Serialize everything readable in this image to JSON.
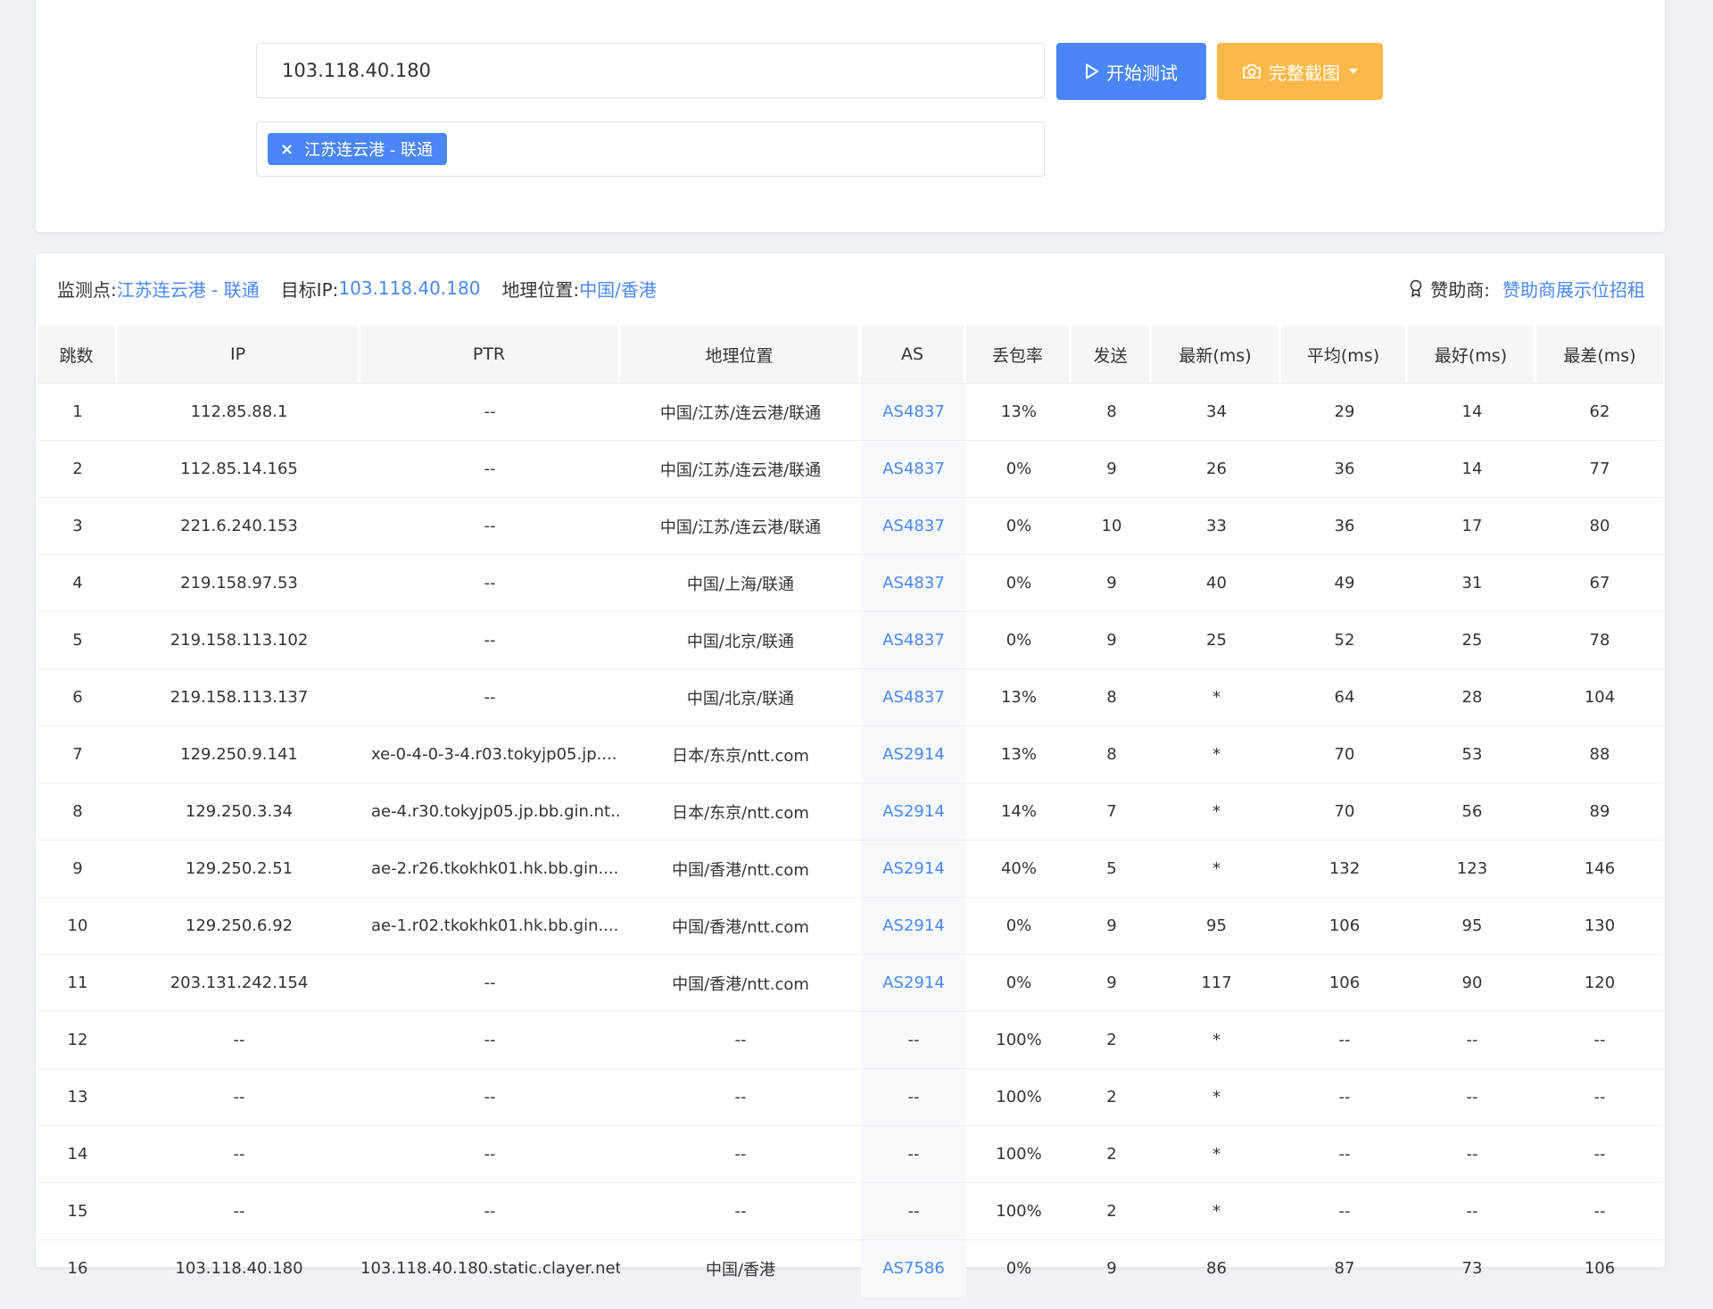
{
  "search": {
    "target": "103.118.40.180",
    "start_label": "开始测试",
    "screenshot_label": "完整截图",
    "selected_node": "江苏连云港 - 联通"
  },
  "info": {
    "monitor_label": "监测点:",
    "monitor_value": "江苏连云港 - 联通",
    "target_label": "目标IP:",
    "target_value": "103.118.40.180",
    "geo_label": "地理位置:",
    "geo_value": "中国/香港",
    "sponsor_label": "赞助商:",
    "sponsor_value": "赞助商展示位招租"
  },
  "table": {
    "headers": [
      "跳数",
      "IP",
      "PTR",
      "地理位置",
      "AS",
      "丢包率",
      "发送",
      "最新(ms)",
      "平均(ms)",
      "最好(ms)",
      "最差(ms)"
    ],
    "rows": [
      [
        "1",
        "112.85.88.1",
        "--",
        "中国/江苏/连云港/联通",
        "AS4837",
        "13%",
        "8",
        "34",
        "29",
        "14",
        "62"
      ],
      [
        "2",
        "112.85.14.165",
        "--",
        "中国/江苏/连云港/联通",
        "AS4837",
        "0%",
        "9",
        "26",
        "36",
        "14",
        "77"
      ],
      [
        "3",
        "221.6.240.153",
        "--",
        "中国/江苏/连云港/联通",
        "AS4837",
        "0%",
        "10",
        "33",
        "36",
        "17",
        "80"
      ],
      [
        "4",
        "219.158.97.53",
        "--",
        "中国/上海/联通",
        "AS4837",
        "0%",
        "9",
        "40",
        "49",
        "31",
        "67"
      ],
      [
        "5",
        "219.158.113.102",
        "--",
        "中国/北京/联通",
        "AS4837",
        "0%",
        "9",
        "25",
        "52",
        "25",
        "78"
      ],
      [
        "6",
        "219.158.113.137",
        "--",
        "中国/北京/联通",
        "AS4837",
        "13%",
        "8",
        "*",
        "64",
        "28",
        "104"
      ],
      [
        "7",
        "129.250.9.141",
        "xe-0-4-0-3-4.r03.tokyjp05.jp....",
        "日本/东京/ntt.com",
        "AS2914",
        "13%",
        "8",
        "*",
        "70",
        "53",
        "88"
      ],
      [
        "8",
        "129.250.3.34",
        "ae-4.r30.tokyjp05.jp.bb.gin.nt...",
        "日本/东京/ntt.com",
        "AS2914",
        "14%",
        "7",
        "*",
        "70",
        "56",
        "89"
      ],
      [
        "9",
        "129.250.2.51",
        "ae-2.r26.tkokhk01.hk.bb.gin....",
        "中国/香港/ntt.com",
        "AS2914",
        "40%",
        "5",
        "*",
        "132",
        "123",
        "146"
      ],
      [
        "10",
        "129.250.6.92",
        "ae-1.r02.tkokhk01.hk.bb.gin....",
        "中国/香港/ntt.com",
        "AS2914",
        "0%",
        "9",
        "95",
        "106",
        "95",
        "130"
      ],
      [
        "11",
        "203.131.242.154",
        "--",
        "中国/香港/ntt.com",
        "AS2914",
        "0%",
        "9",
        "117",
        "106",
        "90",
        "120"
      ],
      [
        "12",
        "--",
        "--",
        "--",
        "--",
        "100%",
        "2",
        "*",
        "--",
        "--",
        "--"
      ],
      [
        "13",
        "--",
        "--",
        "--",
        "--",
        "100%",
        "2",
        "*",
        "--",
        "--",
        "--"
      ],
      [
        "14",
        "--",
        "--",
        "--",
        "--",
        "100%",
        "2",
        "*",
        "--",
        "--",
        "--"
      ],
      [
        "15",
        "--",
        "--",
        "--",
        "--",
        "100%",
        "2",
        "*",
        "--",
        "--",
        "--"
      ],
      [
        "16",
        "103.118.40.180",
        "103.118.40.180.static.clayer.net",
        "中国/香港",
        "AS7586",
        "0%",
        "9",
        "86",
        "87",
        "73",
        "106"
      ]
    ]
  }
}
